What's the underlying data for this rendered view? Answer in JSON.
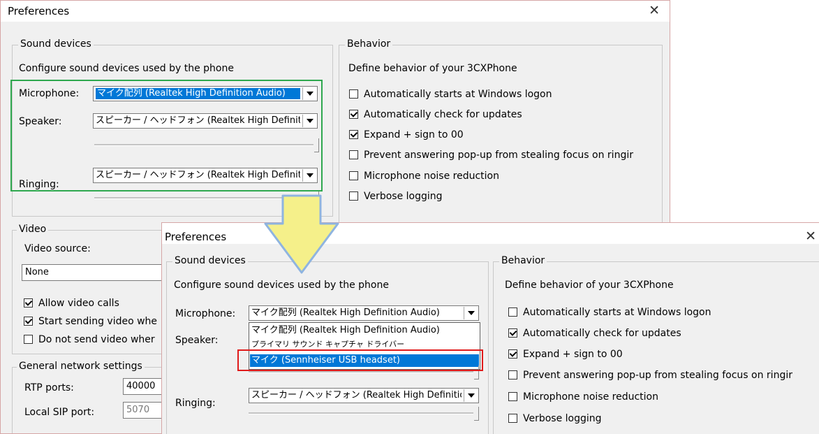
{
  "back": {
    "title": "Preferences",
    "sound": {
      "group_label": "Sound devices",
      "description": "Configure sound devices used by the phone",
      "microphone_label": "Microphone:",
      "microphone_value": "マイク配列 (Realtek High Definition Audio)",
      "speaker_label": "Speaker:",
      "speaker_value": "スピーカー / ヘッドフォン (Realtek High Definition Audio)",
      "ringing_label": "Ringing:",
      "ringing_value": "スピーカー / ヘッドフォン (Realtek High Definition Audio)"
    },
    "behavior": {
      "group_label": "Behavior",
      "description": "Define behavior of your 3CXPhone",
      "options": [
        {
          "label": "Automatically starts at Windows logon",
          "checked": false
        },
        {
          "label": "Automatically check for updates",
          "checked": true
        },
        {
          "label": "Expand + sign to 00",
          "checked": true
        },
        {
          "label": "Prevent answering pop-up from stealing focus on ringir",
          "checked": false
        },
        {
          "label": "Microphone noise reduction",
          "checked": false
        },
        {
          "label": "Verbose logging",
          "checked": false
        }
      ]
    },
    "video": {
      "group_label": "Video",
      "source_label": "Video source:",
      "source_value": "None",
      "options": [
        {
          "label": "Allow video calls",
          "checked": true
        },
        {
          "label": "Start sending video whe",
          "checked": true
        },
        {
          "label": "Do not send video wher",
          "checked": false
        }
      ]
    },
    "network": {
      "group_label": "General network settings",
      "rtp_label": "RTP ports:",
      "rtp_value": "40000",
      "sip_label": "Local SIP port:",
      "sip_value": "5070"
    }
  },
  "front": {
    "title": "Preferences",
    "sound": {
      "group_label": "Sound devices",
      "description": "Configure sound devices used by the phone",
      "microphone_label": "Microphone:",
      "microphone_value": "マイク配列 (Realtek High Definition Audio)",
      "speaker_label": "Speaker:",
      "ringing_label": "Ringing:",
      "ringing_value": "スピーカー / ヘッドフォン (Realtek High Definition Audio)",
      "dropdown_options": [
        {
          "label": "マイク配列 (Realtek High Definition Audio)",
          "highlighted": false
        },
        {
          "label": "プライマリ サウンド キャプチャ ドライバー",
          "highlighted": false
        },
        {
          "label": "マイク (Sennheiser USB headset)",
          "highlighted": true
        }
      ]
    },
    "behavior": {
      "group_label": "Behavior",
      "description": "Define behavior of your 3CXPhone",
      "options": [
        {
          "label": "Automatically starts at Windows logon",
          "checked": false
        },
        {
          "label": "Automatically check for updates",
          "checked": true
        },
        {
          "label": "Expand + sign to 00",
          "checked": true
        },
        {
          "label": "Prevent answering pop-up from stealing focus on ringir",
          "checked": false
        },
        {
          "label": "Microphone noise reduction",
          "checked": false
        },
        {
          "label": "Verbose logging",
          "checked": false
        }
      ]
    }
  },
  "colors": {
    "highlight_green": "#2fa84f",
    "highlight_red": "#e01b1b",
    "arrow_fill": "#f5f08a",
    "arrow_stroke": "#8fb4e0",
    "selection_blue": "#0078d7"
  },
  "icons": {
    "close": "close-icon",
    "dropdown": "chevron-down-icon",
    "annotation": "down-arrow-annotation"
  }
}
